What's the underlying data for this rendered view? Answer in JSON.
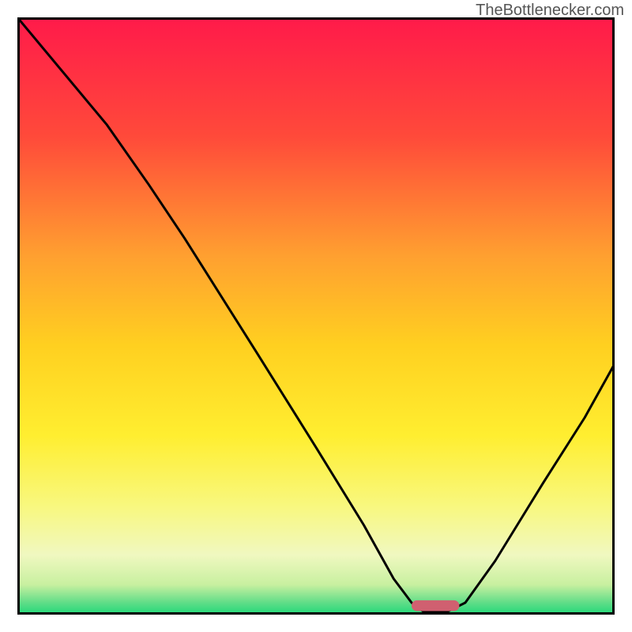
{
  "watermark": "TheBottlenecker.com",
  "chart_data": {
    "type": "line",
    "title": "",
    "xlabel": "",
    "ylabel": "",
    "xlim": [
      0,
      100
    ],
    "ylim": [
      0,
      100
    ],
    "background_gradient": {
      "stops": [
        {
          "offset": 0,
          "color": "#ff1a4a"
        },
        {
          "offset": 20,
          "color": "#ff4a3a"
        },
        {
          "offset": 40,
          "color": "#ffa030"
        },
        {
          "offset": 55,
          "color": "#ffd020"
        },
        {
          "offset": 70,
          "color": "#ffee30"
        },
        {
          "offset": 82,
          "color": "#f8f880"
        },
        {
          "offset": 90,
          "color": "#f0f8c0"
        },
        {
          "offset": 95,
          "color": "#c8f0a0"
        },
        {
          "offset": 98,
          "color": "#60dd88"
        },
        {
          "offset": 100,
          "color": "#20d878"
        }
      ]
    },
    "curve": [
      {
        "x": 0,
        "y": 100
      },
      {
        "x": 15,
        "y": 82
      },
      {
        "x": 22,
        "y": 72
      },
      {
        "x": 28,
        "y": 63
      },
      {
        "x": 40,
        "y": 44
      },
      {
        "x": 50,
        "y": 28
      },
      {
        "x": 58,
        "y": 15
      },
      {
        "x": 63,
        "y": 6
      },
      {
        "x": 66,
        "y": 2
      },
      {
        "x": 68,
        "y": 0.5
      },
      {
        "x": 72,
        "y": 0.5
      },
      {
        "x": 75,
        "y": 2
      },
      {
        "x": 80,
        "y": 9
      },
      {
        "x": 88,
        "y": 22
      },
      {
        "x": 95,
        "y": 33
      },
      {
        "x": 100,
        "y": 42
      }
    ],
    "marker": {
      "x": 70,
      "y": 1.5,
      "width": 8,
      "height": 1.8,
      "color": "#d06070"
    },
    "border_color": "#000000"
  }
}
